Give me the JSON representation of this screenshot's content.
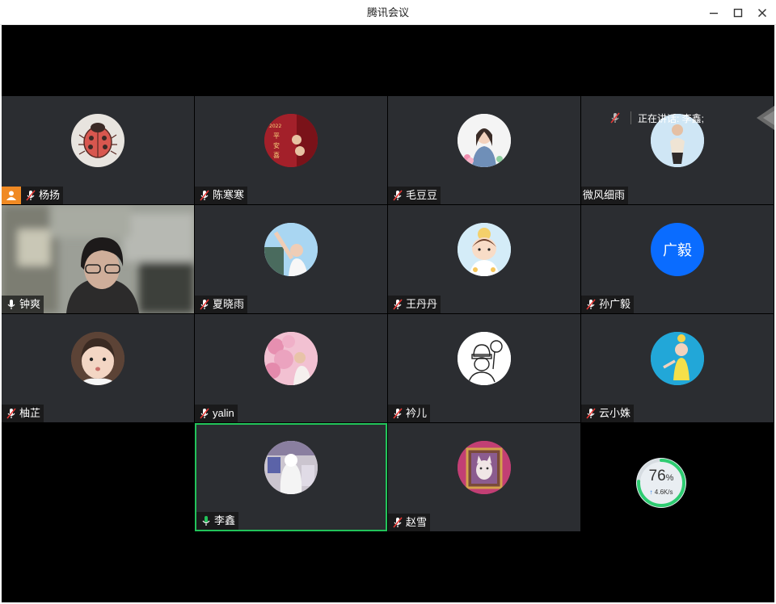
{
  "window": {
    "title": "腾讯会议"
  },
  "speaking": {
    "label": "正在讲话: 李鑫;"
  },
  "participants": [
    {
      "name": "杨扬",
      "mic": "muted",
      "host": true,
      "avatar": "ladybug-drawing-avatar"
    },
    {
      "name": "陈寒寒",
      "mic": "muted",
      "avatar": "red-new-year-avatar",
      "avatar_text": "2022 平安喜"
    },
    {
      "name": "毛豆豆",
      "mic": "muted",
      "avatar": "cartoon-girl-avatar"
    },
    {
      "name": "微风细雨",
      "mic": "none",
      "avatar": "woman-photo-avatar"
    },
    {
      "name": "钟爽",
      "mic": "on",
      "video": true,
      "avatar": "camera-video-feed"
    },
    {
      "name": "夏晓雨",
      "mic": "muted",
      "avatar": "selfie-photo-avatar"
    },
    {
      "name": "王丹丹",
      "mic": "muted",
      "avatar": "cartoon-bun-girl-avatar"
    },
    {
      "name": "孙广毅",
      "mic": "muted",
      "avatar": "text-avatar",
      "avatar_text": "广毅"
    },
    {
      "name": "柚芷",
      "mic": "muted",
      "avatar": "child-photo-avatar"
    },
    {
      "name": "yalin",
      "mic": "muted",
      "avatar": "cherry-blossom-avatar"
    },
    {
      "name": "衿儿",
      "mic": "muted",
      "avatar": "line-drawing-avatar"
    },
    {
      "name": "云小姝",
      "mic": "muted",
      "avatar": "child-yellow-dress-avatar"
    },
    {
      "name": "李鑫",
      "mic": "speaking",
      "active": true,
      "avatar": "white-costume-avatar"
    },
    {
      "name": "赵雪",
      "mic": "muted",
      "avatar": "cat-painting-avatar"
    }
  ],
  "network": {
    "percent": "76",
    "percent_sign": "%",
    "speed": "4.6K/s",
    "fraction": 0.76
  },
  "colors": {
    "tile": "#2b2d31",
    "active_border": "#22c35a",
    "host": "#f08a24",
    "text_avatar": "#0a6cff"
  }
}
